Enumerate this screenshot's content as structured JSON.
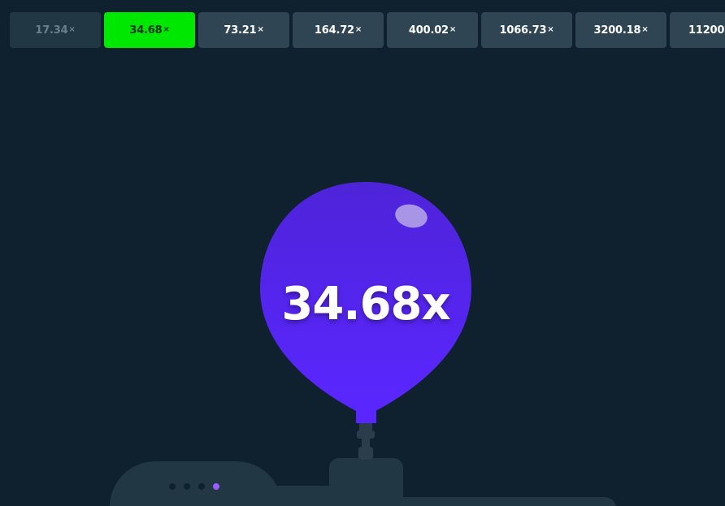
{
  "multipliers": {
    "suffix": "×",
    "items": [
      {
        "value": "17.34",
        "state": "past"
      },
      {
        "value": "34.68",
        "state": "active"
      },
      {
        "value": "73.21",
        "state": "upcoming"
      },
      {
        "value": "164.72",
        "state": "upcoming"
      },
      {
        "value": "400.02",
        "state": "upcoming"
      },
      {
        "value": "1066.73",
        "state": "upcoming"
      },
      {
        "value": "3200.18",
        "state": "upcoming"
      },
      {
        "value": "11200",
        "state": "upcoming"
      }
    ]
  },
  "balloon": {
    "label": "34.68x",
    "color_top": "#4e24d9",
    "color_bottom": "#5a26ff"
  },
  "pump": {
    "dots_total": 4,
    "dots_active_index": 3
  },
  "colors": {
    "background": "#0f212e",
    "pill": "#2f4553",
    "pill_past": "#213743",
    "pill_active": "#00e701",
    "machine": "#213743",
    "indicator_on": "#9b5cff"
  }
}
